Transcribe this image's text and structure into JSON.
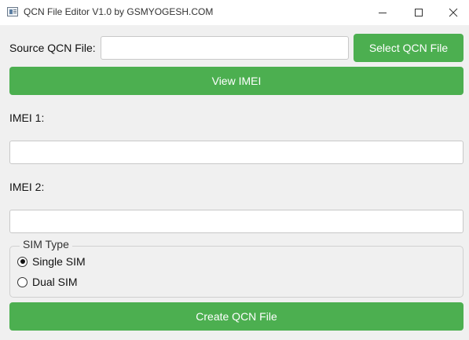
{
  "window": {
    "title": "QCN File Editor V1.0 by GSMYOGESH.COM"
  },
  "source": {
    "label": "Source QCN File:",
    "value": "",
    "select_button": "Select QCN File"
  },
  "view_imei_button": "View IMEI",
  "imei1": {
    "label": "IMEI 1:",
    "value": ""
  },
  "imei2": {
    "label": "IMEI 2:",
    "value": ""
  },
  "sim_type": {
    "legend": "SIM Type",
    "options": [
      {
        "label": "Single SIM",
        "checked": true
      },
      {
        "label": "Dual SIM",
        "checked": false
      }
    ]
  },
  "create_button": "Create QCN File",
  "colors": {
    "accent": "#4caf50",
    "window_bg": "#f0f0f0",
    "titlebar_bg": "#ffffff"
  },
  "icons": {
    "app": "app-icon",
    "minimize": "minimize-icon",
    "maximize": "maximize-icon",
    "close": "close-icon"
  }
}
